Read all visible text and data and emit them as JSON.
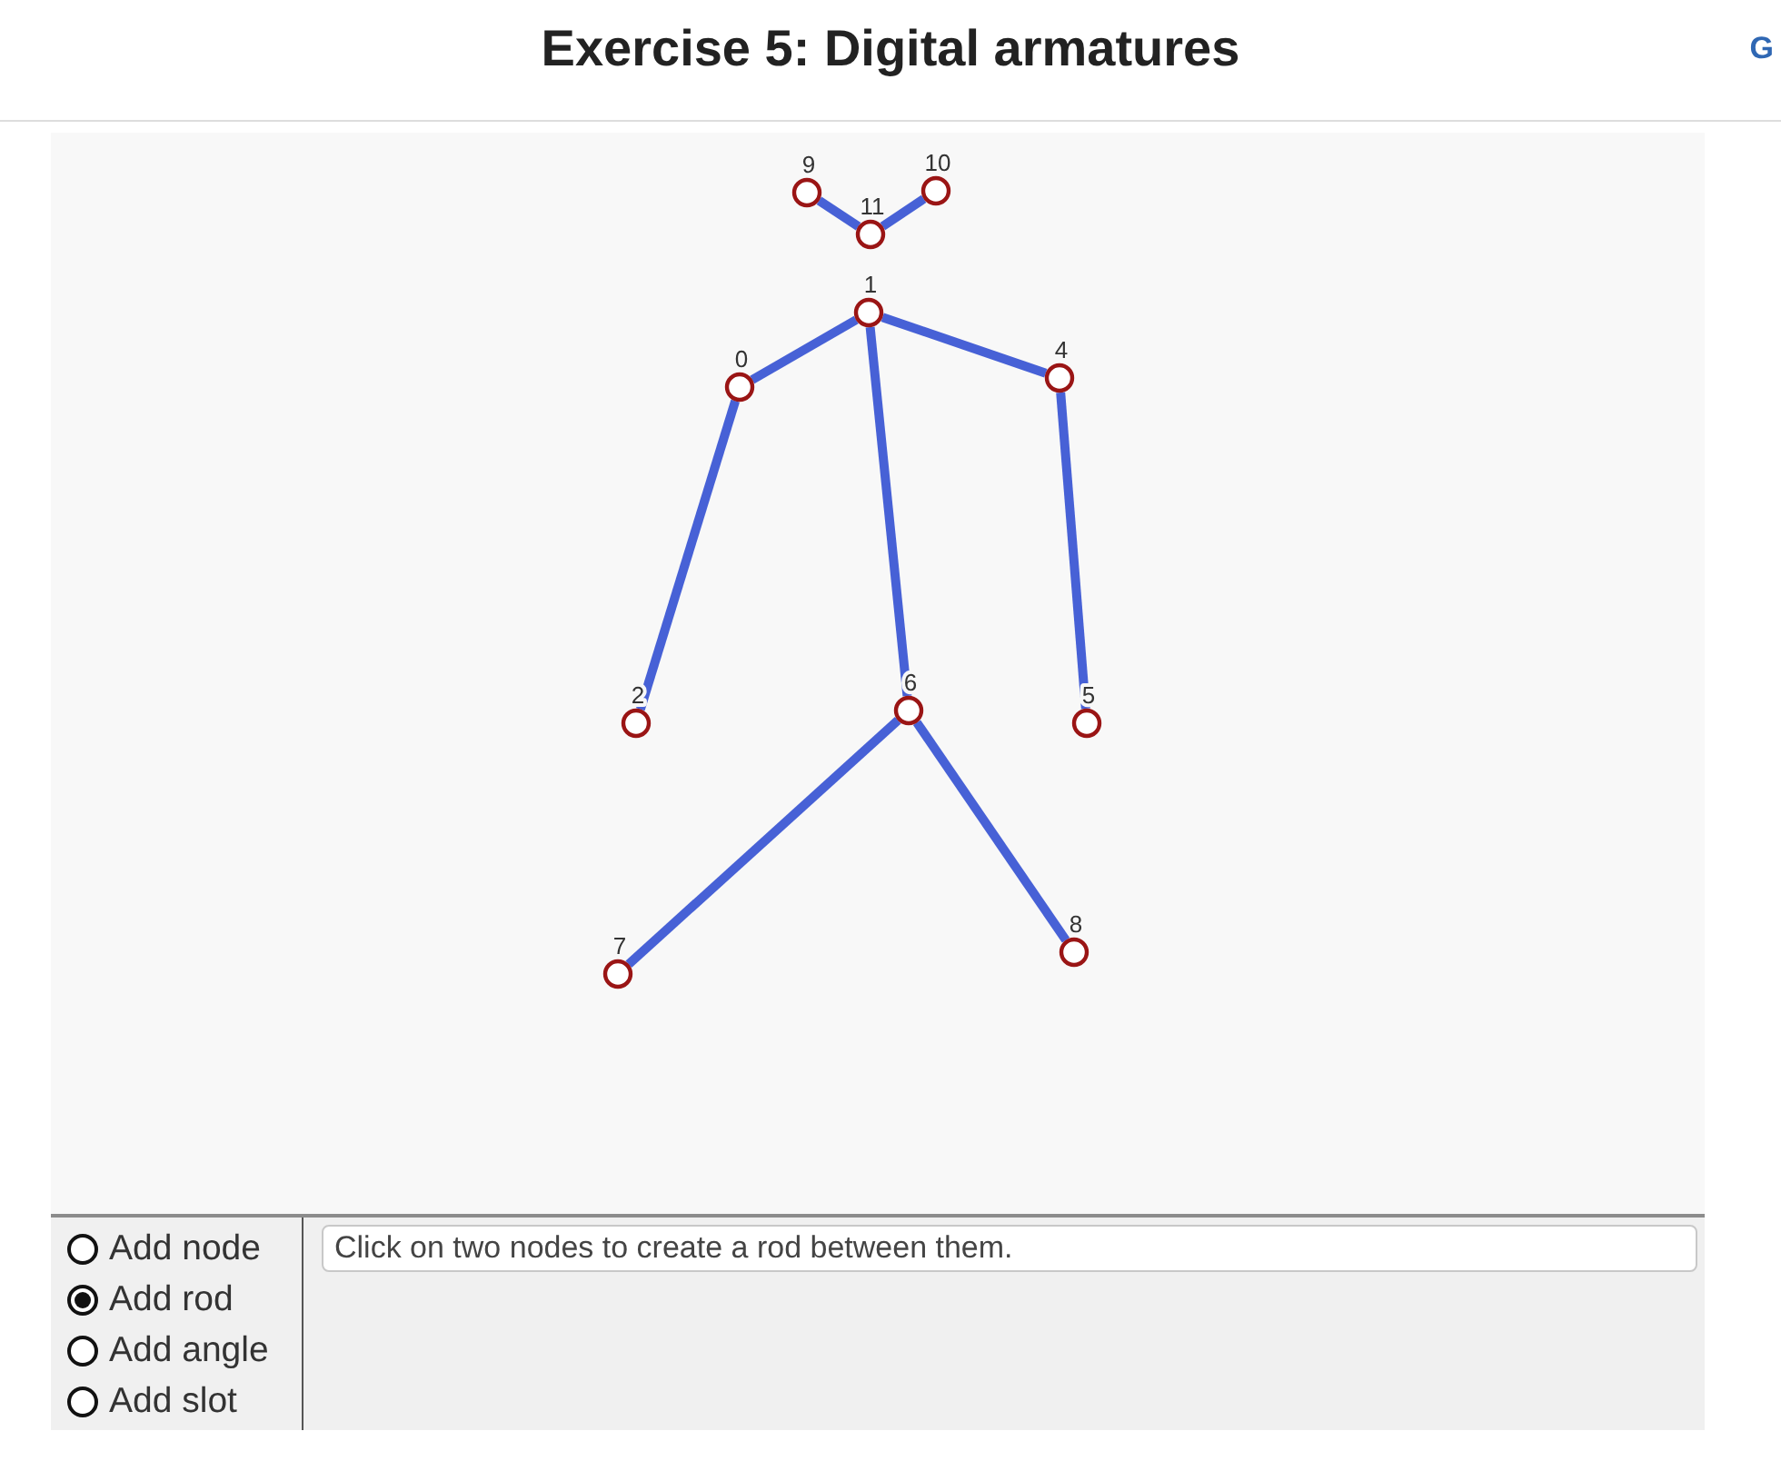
{
  "title": "Exercise 5: Digital armatures",
  "header_link": "G",
  "armature": {
    "nodes": [
      {
        "label": "11",
        "children": [
          {
            "label": "9"
          },
          {
            "label": "10"
          }
        ]
      },
      {
        "label": "1",
        "children": [
          {
            "label": "0",
            "children": [
              {
                "label": "2"
              }
            ]
          },
          {
            "label": "4",
            "children": [
              {
                "label": "5"
              }
            ]
          },
          {
            "label": "6",
            "children": [
              {
                "label": "7"
              },
              {
                "label": "8"
              }
            ]
          }
        ]
      }
    ]
  },
  "modes": [
    {
      "label": "Add node",
      "selected": false
    },
    {
      "label": "Add rod",
      "selected": true
    },
    {
      "label": "Add angle",
      "selected": false
    },
    {
      "label": "Add slot",
      "selected": false
    }
  ],
  "message": "Click on two nodes to create a rod between them."
}
